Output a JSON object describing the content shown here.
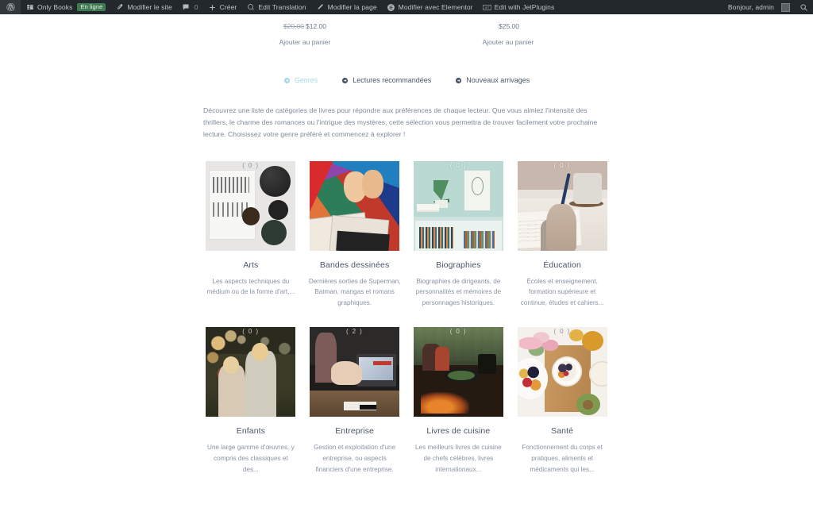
{
  "adminbar": {
    "logo_icon": "wordpress-logo-icon",
    "site_name": "Only Books",
    "online_badge": "En ligne",
    "edit_site": "Modifier le site",
    "comments_count": "0",
    "new": "Créer",
    "edit_translation": "Edit Translation",
    "edit_page": "Modifier la page",
    "edit_elementor": "Modifier avec Elementor",
    "edit_jetplugins": "Edit with JetPlugins",
    "jet_badge": "JET",
    "greeting": "Bonjour, admin",
    "search_icon": "search-icon"
  },
  "products": [
    {
      "old_price": "$20.00",
      "price": "$12.00",
      "add_to_cart": "Ajouter au panier"
    },
    {
      "old_price": "",
      "price": "$25.00",
      "add_to_cart": "Ajouter au panier"
    }
  ],
  "tabs": [
    {
      "label": "Genres",
      "active": true
    },
    {
      "label": "Lectures recommandées",
      "active": false
    },
    {
      "label": "Nouveaux arrivages",
      "active": false
    }
  ],
  "intro": "Découvrez une liste de catégories de livres pour répondre aux préférences de chaque lecteur. Que vous aimiez l'intensité des thrillers, le charme des romances ou l'intrigue des mystères, cette sélection vous permettra de trouver facilement votre prochaine lecture. Choisissez votre genre préféré et commencez à explorer !",
  "genres": [
    {
      "title": "Arts",
      "count": "( 0 )",
      "desc": "Les aspects techniques du médium ou de la forme d'art,...",
      "image": "arts-flatlay-photo"
    },
    {
      "title": "Bandes dessinées",
      "count": "",
      "desc": "Dernières sorties de Superman, Batman, mangas et romans graphiques.",
      "image": "comic-books-photo"
    },
    {
      "title": "Biographies",
      "count": "( 0 )",
      "desc": "Biographies de dirigeants, de personnalités et mémoires de personnages historiques.",
      "image": "bookshelf-portrait-photo"
    },
    {
      "title": "Éducation",
      "count": "( 0 )",
      "desc": "Écoles et enseignement, formation supérieure et continue, études et cahiers...",
      "image": "writing-hand-photo"
    },
    {
      "title": "Enfants",
      "count": "( 0 )",
      "desc": "Une large gamme d'œuvres, y compris des classiques et des...",
      "image": "two-children-photo"
    },
    {
      "title": "Entreprise",
      "count": "( 2 )",
      "desc": "Gestion et exploitation d'une entreprise, ou aspects financiers d'une entreprise.",
      "image": "business-meeting-photo"
    },
    {
      "title": "Livres de cuisine",
      "count": "( 0 )",
      "desc": "Les meilleurs livres de cuisine de chefs célèbres, livres internationaux...",
      "image": "outdoor-cooking-photo"
    },
    {
      "title": "Santé",
      "count": "( 0 )",
      "desc": "Fonctionnement du corps et pratiques, aliments et médicaments qui les...",
      "image": "healthy-food-flatlay-photo"
    }
  ],
  "colors": {
    "adminbar_bg": "#23282d",
    "adminbar_text": "#c3c4c7",
    "online_badge_bg": "#3f7a52",
    "tab_active": "#a8d8e8",
    "heading": "#4a5668",
    "body_text": "#8a93a4",
    "page_bg": "#ffffff"
  }
}
